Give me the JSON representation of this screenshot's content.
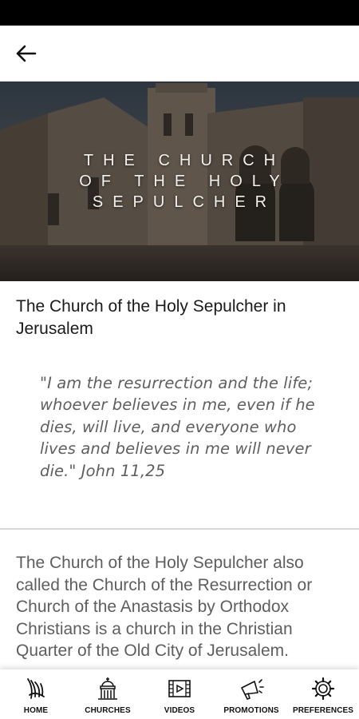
{
  "hero": {
    "title": "THE CHURCH\nOF THE HOLY\nSEPULCHER"
  },
  "article": {
    "title": "The Church of the Holy Sepulcher in Jerusalem",
    "quote": "\"I am the resurrection and the life; whoever believes in me, even if he dies, will live, and everyone who lives and believes in me will never die.\" John 11,25",
    "body": "The Church of the Holy Sepulcher also called the Church of the Resurrection or Church of the Anastasis by Orthodox Christians is a church in the Christian Quarter of the Old City of Jerusalem."
  },
  "nav": {
    "items": [
      {
        "label": "HOME",
        "icon": "home-icon"
      },
      {
        "label": "CHURCHES",
        "icon": "church-icon"
      },
      {
        "label": "VIDEOS",
        "icon": "video-icon"
      },
      {
        "label": "PROMOTIONS",
        "icon": "megaphone-icon"
      },
      {
        "label": "PREFERENCES",
        "icon": "gear-icon"
      }
    ]
  }
}
